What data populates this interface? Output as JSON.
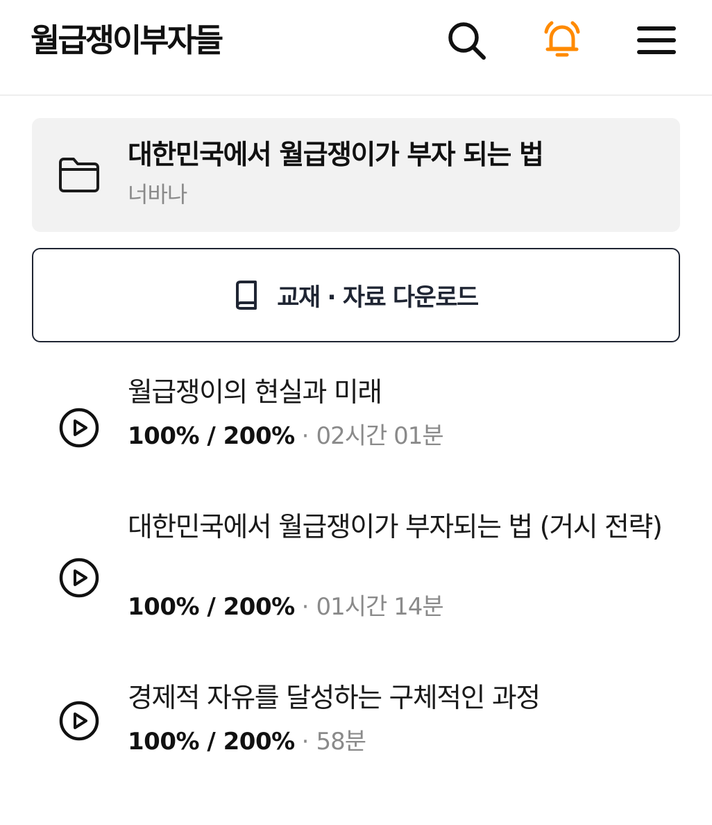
{
  "header": {
    "logo": "월급쟁이부자들",
    "search_icon": "search-icon",
    "bell_icon": "bell-icon",
    "menu_icon": "hamburger-menu-icon",
    "bell_color": "#FF8A00"
  },
  "course": {
    "title": "대한민국에서 월급쟁이가 부자 되는 법",
    "author": "너바나",
    "icon": "folder-icon"
  },
  "download": {
    "label": "교재 · 자료 다운로드",
    "icon": "book-icon"
  },
  "lessons": [
    {
      "title": "월급쟁이의 현실과 미래",
      "progress": "100% / 200%",
      "separator": "·",
      "duration": "02시간 01분",
      "icon": "play-circle-icon"
    },
    {
      "title": "대한민국에서 월급쟁이가 부자되는 법 (거시 전략)",
      "progress": "100% / 200%",
      "separator": "·",
      "duration": "01시간 14분",
      "icon": "play-circle-icon"
    },
    {
      "title": "경제적 자유를 달성하는 구체적인 과정",
      "progress": "100% / 200%",
      "separator": "·",
      "duration": "58분",
      "icon": "play-circle-icon"
    }
  ]
}
